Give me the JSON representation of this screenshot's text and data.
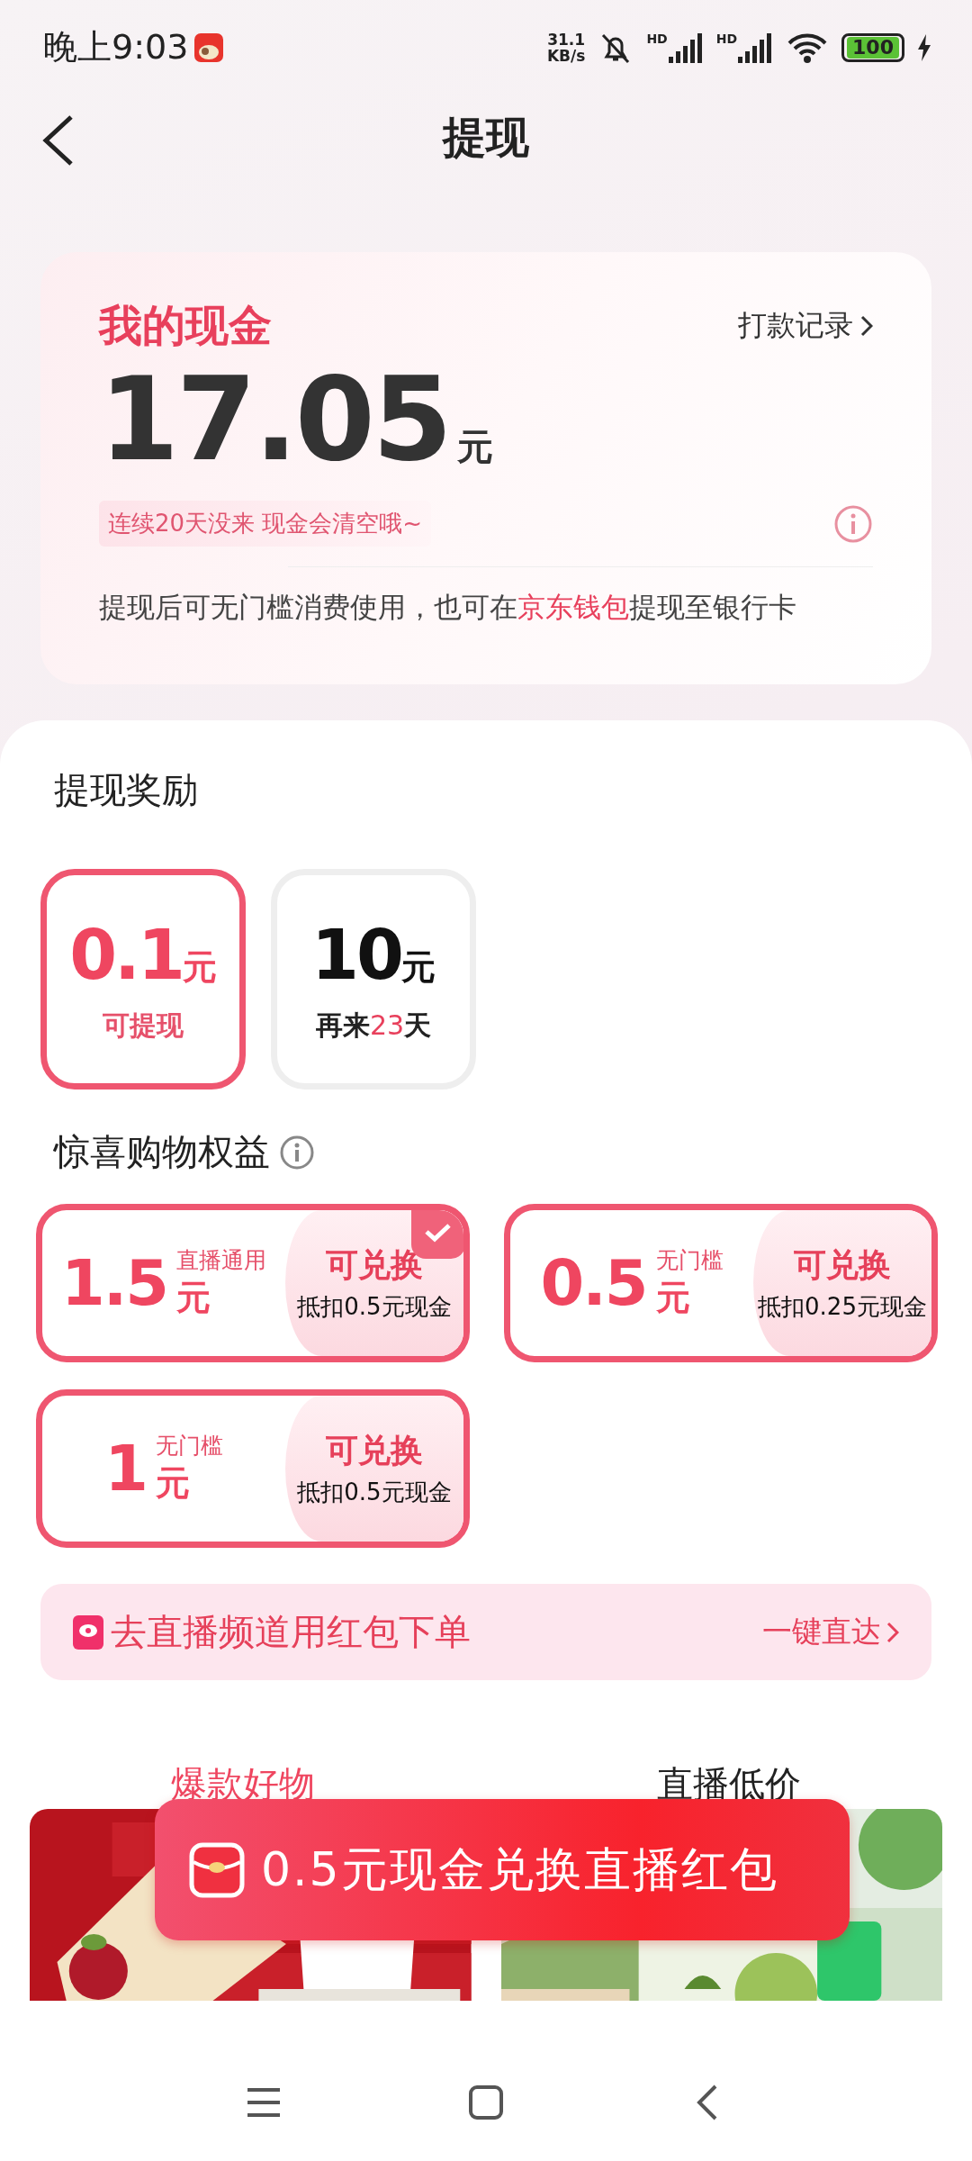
{
  "status_bar": {
    "time": "晚上9:03",
    "net_speed": [
      "31.1",
      "KB/s"
    ],
    "signal_labels": [
      "HD",
      "HD"
    ],
    "battery": "100"
  },
  "header": {
    "title": "提现"
  },
  "cash_card": {
    "title": "我的现金",
    "link": "打款记录",
    "amount": "17.05",
    "unit": "元",
    "warning": "连续20天没来 现金会清空哦~",
    "note_before": "提现后可无门槛消费使用，也可在",
    "note_link": "京东钱包",
    "note_after": "提现至银行卡"
  },
  "rewards": {
    "title": "提现奖励",
    "tiles": [
      {
        "amount": "0.1",
        "unit": "元",
        "selected": true,
        "caption": [
          {
            "text": "可提现",
            "highlight": false
          }
        ]
      },
      {
        "amount": "10",
        "unit": "元",
        "selected": false,
        "caption": [
          {
            "text": "再来",
            "highlight": false
          },
          {
            "text": "23",
            "highlight": true
          },
          {
            "text": "天",
            "highlight": false
          }
        ]
      }
    ]
  },
  "benefits": {
    "title": "惊喜购物权益",
    "coupons": [
      {
        "amount": "1.5",
        "tag": "直播通用",
        "unit": "元",
        "action": "可兑换",
        "cost": "抵扣0.5元现金",
        "selected": true
      },
      {
        "amount": "0.5",
        "tag": "无门槛",
        "unit": "元",
        "action": "可兑换",
        "cost": "抵扣0.25元现金",
        "selected": false
      },
      {
        "amount": "1",
        "tag": "无门槛",
        "unit": "元",
        "action": "可兑换",
        "cost": "抵扣0.5元现金",
        "selected": false
      }
    ]
  },
  "live_banner": {
    "text": "去直播频道用红包下单",
    "link": "一键直达"
  },
  "tabs": [
    {
      "label": "爆款好物",
      "selected": true
    },
    {
      "label": "直播低价",
      "selected": false
    }
  ],
  "toast": {
    "text": "0.5元现金兑换直播红包"
  }
}
